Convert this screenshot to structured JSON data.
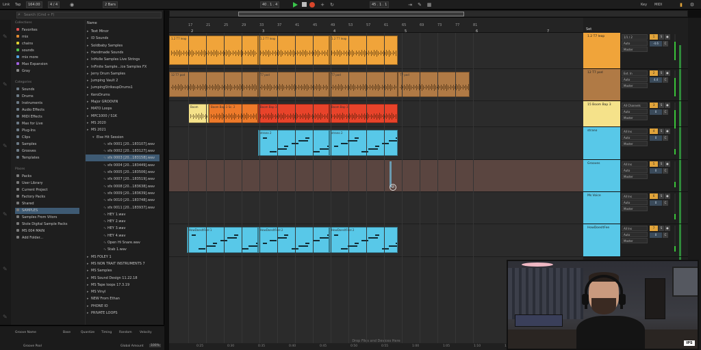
{
  "transport": {
    "link": "Link",
    "tap": "Tap",
    "tempo": "164.00",
    "signature": "4 / 4",
    "quantize": "2 Bars",
    "position": "40 . 1 . 4",
    "loop_start": "45 . 1 . 1",
    "key_label": "Key",
    "midi_label": "MIDI"
  },
  "browser": {
    "search_placeholder": "Search (Cmd + F)",
    "collections_header": "Collections",
    "collections": [
      {
        "label": "Favorites",
        "color": "#e05050"
      },
      {
        "label": "mix",
        "color": "#e08a30"
      },
      {
        "label": "chains",
        "color": "#e0d030"
      },
      {
        "label": "sounds",
        "color": "#50c050"
      },
      {
        "label": "mix more",
        "color": "#50a0e0"
      },
      {
        "label": "Max Expansion",
        "color": "#a060e0"
      },
      {
        "label": "Gray",
        "color": "#888888"
      }
    ],
    "categories_header": "Categories",
    "categories": [
      "Sounds",
      "Drums",
      "Instruments",
      "Audio Effects",
      "MIDI Effects",
      "Max for Live",
      "Plug-Ins",
      "Clips",
      "Samples",
      "Grooves",
      "Templates"
    ],
    "places_header": "Places",
    "places": [
      "Packs",
      "User Library",
      "Current Project",
      "Factory Packs",
      "Shared",
      "SAMPLES",
      "Samples From Vitors",
      "Stole Digital Sample Packs",
      "MS 004 MAIN",
      "Add Folder..."
    ],
    "places_selected": "SAMPLES",
    "name_header": "Name",
    "files": [
      {
        "label": "Text Minor",
        "icon": "folder"
      },
      {
        "label": "ID Sounds",
        "icon": "folder"
      },
      {
        "label": "Soldbaby Samples",
        "icon": "folder"
      },
      {
        "label": "Handmade Sounds",
        "icon": "folder"
      },
      {
        "label": "InHolle Samples Live Strings",
        "icon": "folder"
      },
      {
        "label": "InFinite Sample...ice Samples FX",
        "icon": "folder"
      },
      {
        "label": "Jerry Drum Samples",
        "icon": "folder"
      },
      {
        "label": "Jumping Vault 2",
        "icon": "folder"
      },
      {
        "label": "JumpingStrikeupDrums1",
        "icon": "folder"
      },
      {
        "label": "KeroDrums",
        "icon": "folder"
      },
      {
        "label": "Major GROOVIN",
        "icon": "folder"
      },
      {
        "label": "MATO Loops",
        "icon": "folder"
      },
      {
        "label": "MPC1000 / S1K",
        "icon": "folder"
      },
      {
        "label": "MS 2020",
        "icon": "folder"
      },
      {
        "label": "MS 2021",
        "icon": "folder"
      },
      {
        "label": "Else Hit Session",
        "icon": "folder-open"
      },
      {
        "label": "sfx 0001 [20...183107].wav",
        "icon": "wave"
      },
      {
        "label": "sfx 0002 [20...183127].wav",
        "icon": "wave"
      },
      {
        "label": "sfx 0003 [20...183158].wav",
        "icon": "wave"
      },
      {
        "label": "sfx 0004 [20...183449].wav",
        "icon": "wave"
      },
      {
        "label": "sfx 0005 [20...183506].wav",
        "icon": "wave"
      },
      {
        "label": "sfx 0007 [20...183519].wav",
        "icon": "wave"
      },
      {
        "label": "sfx 0008 [20...183638].wav",
        "icon": "wave"
      },
      {
        "label": "sfx 0009 [20...183639].wav",
        "icon": "wave"
      },
      {
        "label": "sfx 0010 [20...183748].wav",
        "icon": "wave"
      },
      {
        "label": "sfx 0011 [20...183937].wav",
        "icon": "wave"
      },
      {
        "label": "HEY 1.wav",
        "icon": "wave"
      },
      {
        "label": "HEY 2.wav",
        "icon": "wave"
      },
      {
        "label": "HEY 3.wav",
        "icon": "wave"
      },
      {
        "label": "HEY 4.wav",
        "icon": "wave"
      },
      {
        "label": "Open Hi Snare.wav",
        "icon": "wave"
      },
      {
        "label": "Stab 1.wav",
        "icon": "wave"
      },
      {
        "label": "MS FOLEY 1",
        "icon": "folder"
      },
      {
        "label": "MS NON TRAIT INSTRUMENTS 7",
        "icon": "folder"
      },
      {
        "label": "MS Samples",
        "icon": "folder"
      },
      {
        "label": "MS Sound Design 11.22.18",
        "icon": "folder"
      },
      {
        "label": "MS Tape loops 17.3.19",
        "icon": "folder"
      },
      {
        "label": "MS Vinyl",
        "icon": "folder"
      },
      {
        "label": "NEW From Ethan",
        "icon": "folder"
      },
      {
        "label": "PHONE IO",
        "icon": "folder"
      },
      {
        "label": "PRIVATE LOOPS",
        "icon": "folder"
      }
    ],
    "selected_file_index": 18
  },
  "groove": {
    "name": "Groove Name",
    "base": "Base",
    "quantize": "Quantize",
    "timing": "Timing",
    "random": "Random",
    "velocity": "Velocity",
    "pool": "Groove Pool",
    "global_amount_label": "Global Amount",
    "global_amount": "100%"
  },
  "arrangement": {
    "ruler_numbers": [
      "17",
      "21",
      "25",
      "29",
      "33",
      "37",
      "41",
      "45",
      "49",
      "53",
      "57",
      "61",
      "65",
      "69",
      "73",
      "77",
      "81"
    ],
    "bar_markers": [
      "2",
      "3",
      "4",
      "5",
      "6",
      "7",
      "8"
    ],
    "drop_text": "Drop Files and Devices Here",
    "time_labels": [
      "0:25",
      "0:30",
      "0:35",
      "0:40",
      "0:45",
      "0:50",
      "0:55",
      "1:00",
      "1:05",
      "1:10",
      "1:15"
    ],
    "tracks": [
      {
        "clips": [
          {
            "label": "1.2 T7 leap",
            "color": "#f0a43a"
          },
          {
            "label": "1.2 T7 leap",
            "color": "#f0a43a"
          },
          {
            "label": "1.2 T7 leap",
            "color": "#f0a43a"
          }
        ]
      },
      {
        "clips": [
          {
            "label": "12 T7 pod",
            "color": "#b07a45"
          },
          {
            "label": "T7 pod",
            "color": "#b07a45"
          },
          {
            "label": "T7 pod",
            "color": "#b07a45"
          },
          {
            "label": "T7 pod",
            "color": "#b07a45"
          }
        ]
      },
      {
        "clips": [
          {
            "label": "Boom",
            "color": "#f5e28a"
          },
          {
            "label": "Boom Bap 3 Sc. 2",
            "color": "#ee7a2a"
          },
          {
            "label": "Boom Bap 3",
            "color": "#e8432a"
          },
          {
            "label": "Boom Bap 3",
            "color": "#e8432a"
          }
        ]
      },
      {
        "clips": [
          {
            "label": "strano 2",
            "color": "#58c8e8"
          },
          {
            "label": "strano 2",
            "color": "#58c8e8"
          }
        ]
      },
      {
        "clips": []
      },
      {
        "clips": []
      },
      {
        "clips": [
          {
            "label": "HowDoesItFeel 1",
            "color": "#58c8e8"
          },
          {
            "label": "HowDoesItFeel 2",
            "color": "#58c8e8"
          },
          {
            "label": "HowDoesItFeel 2",
            "color": "#58c8e8"
          }
        ]
      }
    ]
  },
  "mixer": {
    "set_label": "Set",
    "tracks": [
      {
        "name": "1.2 T7 leap",
        "color": "#f0a43a",
        "input": "1/1 / 2",
        "monitor": "Auto",
        "out": "Master",
        "num": "1",
        "val": "-4.6"
      },
      {
        "name": "12 T7 pod",
        "color": "#b07a45",
        "input": "Ext. In",
        "monitor": "Auto",
        "out": "Master",
        "num": "2",
        "val": "4.4"
      },
      {
        "name": "15 Boom Bap 3",
        "color": "#f5e28a",
        "input": "All Channels",
        "monitor": "Auto",
        "out": "Master",
        "num": "3",
        "val": "0"
      },
      {
        "name": "strano",
        "color": "#58c8e8",
        "input": "All Ins",
        "monitor": "Auto",
        "out": "Master",
        "num": "4",
        "val": "0"
      },
      {
        "name": "Grooves",
        "color": "#58c8e8",
        "input": "All Ins",
        "monitor": "Auto",
        "out": "Master",
        "num": "5",
        "val": "0"
      },
      {
        "name": "Ms Voice",
        "color": "#58c8e8",
        "input": "All Ins",
        "monitor": "Auto",
        "out": "Master",
        "num": "6",
        "val": "0"
      },
      {
        "name": "HowDoesItFee",
        "color": "#58c8e8",
        "input": "All Ins",
        "monitor": "Auto",
        "out": "Master",
        "num": "7",
        "val": "0"
      }
    ]
  },
  "webcam": {
    "logo": "IPS"
  }
}
